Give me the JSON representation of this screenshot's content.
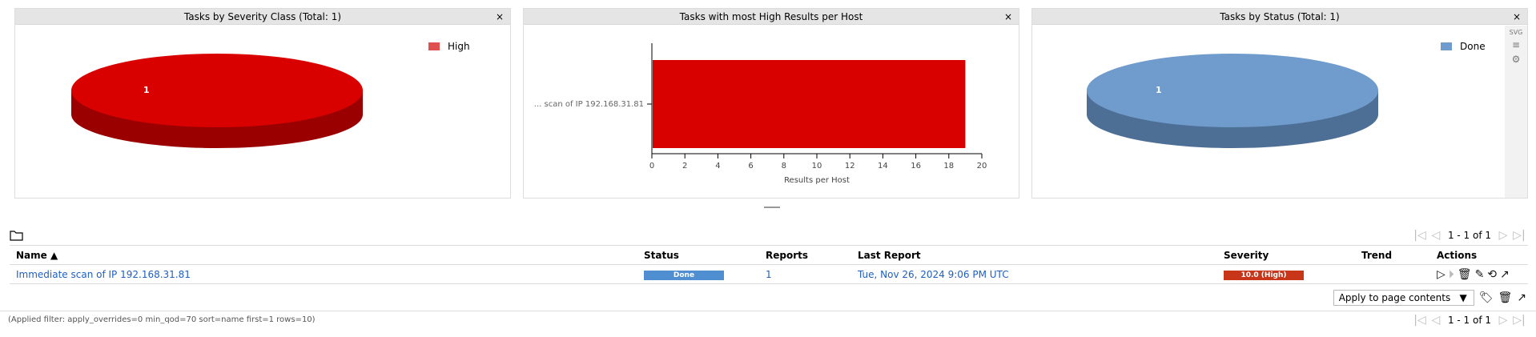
{
  "panels": {
    "severity": {
      "title": "Tasks by Severity Class (Total: 1)",
      "close": "×",
      "legend": "High",
      "slice_label": "1",
      "color": "#d90000"
    },
    "high_results": {
      "title": "Tasks with most High Results per Host",
      "close": "×",
      "ylabel": "... scan of IP 192.168.31.81",
      "xlabel": "Results per Host",
      "ticks": [
        "0",
        "2",
        "4",
        "6",
        "8",
        "10",
        "12",
        "14",
        "16",
        "18",
        "20"
      ],
      "color": "#d90000"
    },
    "status": {
      "title": "Tasks by Status (Total: 1)",
      "close": "×",
      "legend": "Done",
      "slice_label": "1",
      "color": "#6f9ccd",
      "tools": [
        "SVG",
        "≡",
        "⚙"
      ]
    }
  },
  "chart_data": [
    {
      "type": "pie",
      "title": "Tasks by Severity Class (Total: 1)",
      "categories": [
        "High"
      ],
      "values": [
        1
      ]
    },
    {
      "type": "bar",
      "title": "Tasks with most High Results per Host",
      "categories": [
        "... scan of IP 192.168.31.81"
      ],
      "values": [
        19
      ],
      "xlabel": "Results per Host",
      "xlim": [
        0,
        20
      ]
    },
    {
      "type": "pie",
      "title": "Tasks by Status (Total: 1)",
      "categories": [
        "Done"
      ],
      "values": [
        1
      ]
    }
  ],
  "pager": {
    "range": "1 - 1 of 1"
  },
  "table": {
    "headers": {
      "name": "Name ▲",
      "status": "Status",
      "reports": "Reports",
      "last_report": "Last Report",
      "severity": "Severity",
      "trend": "Trend",
      "actions": "Actions"
    },
    "rows": [
      {
        "name": "Immediate scan of IP 192.168.31.81",
        "status": "Done",
        "reports": "1",
        "last_report": "Tue, Nov 26, 2024 9:06 PM UTC",
        "severity": "10.0 (High)",
        "trend": ""
      }
    ]
  },
  "apply": {
    "selected": "Apply to page contents"
  },
  "filter_text": "(Applied filter: apply_overrides=0 min_qod=70 sort=name first=1 rows=10)"
}
